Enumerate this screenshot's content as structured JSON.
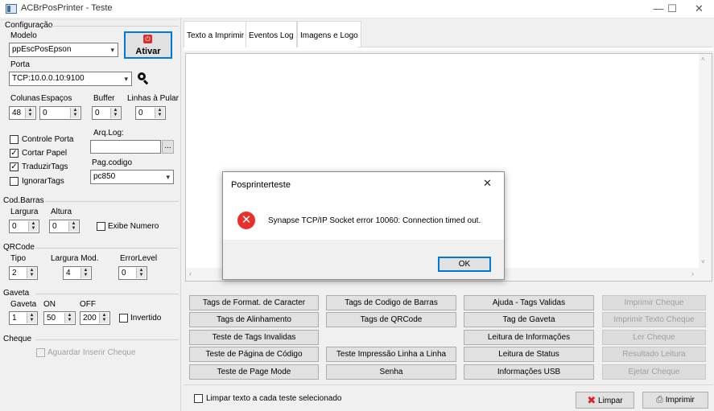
{
  "window": {
    "title": "ACBrPosPrinter - Teste",
    "minimize": "—",
    "maximize": "☐",
    "close": "✕"
  },
  "config": {
    "group_title": "Configuração",
    "modelo_label": "Modelo",
    "modelo_value": "ppEscPosEpson",
    "ativar_label": "Ativar",
    "porta_label": "Porta",
    "porta_value": "TCP:10.0.0.10:9100",
    "colunas_label": "Colunas",
    "colunas_value": "48",
    "espacos_label": "Espaços",
    "espacos_value": "0",
    "buffer_label": "Buffer",
    "buffer_value": "0",
    "linhas_label": "Linhas à Pular",
    "linhas_value": "0",
    "controle_porta": "Controle Porta",
    "cortar_papel": "Cortar Papel",
    "traduzir_tags": "TraduzirTags",
    "ignorar_tags": "IgnorarTags",
    "arqlog_label": "Arq.Log:",
    "arqlog_value": "",
    "browse": "...",
    "pagcodigo_label": "Pag.codigo",
    "pagcodigo_value": "pc850"
  },
  "codbarras": {
    "group_title": "Cod.Barras",
    "largura_label": "Largura",
    "largura_value": "0",
    "altura_label": "Altura",
    "altura_value": "0",
    "exibe_numero": "Exibe Numero"
  },
  "qrcode": {
    "group_title": "QRCode",
    "tipo_label": "Tipo",
    "tipo_value": "2",
    "largura_mod_label": "Largura Mod.",
    "largura_mod_value": "4",
    "error_level_label": "ErrorLevel",
    "error_level_value": "0"
  },
  "gaveta": {
    "group_title": "Gaveta",
    "gaveta_label": "Gaveta",
    "gaveta_value": "1",
    "on_label": "ON",
    "on_value": "50",
    "off_label": "OFF",
    "off_value": "200",
    "invertido": "Invertido"
  },
  "cheque": {
    "group_title": "Cheque",
    "aguardar": "Aguardar Inserir Cheque"
  },
  "tabs": [
    {
      "label": "Texto a Imprimir"
    },
    {
      "label": "Eventos Log"
    },
    {
      "label": "Imagens e Logo"
    }
  ],
  "buttons": {
    "col1": [
      "Tags de Format. de Caracter",
      "Tags de Alinhamento",
      "Teste de Tags Invalidas",
      "Teste de Página de Código",
      "Teste de Page Mode"
    ],
    "col2": [
      "Tags de Codigo de Barras",
      "Tags de QRCode",
      "Teste Impressão Linha a Linha",
      "Senha"
    ],
    "col3": [
      "Ajuda - Tags Validas",
      "Tag de Gaveta",
      "Leitura de Informações",
      "Leitura de Status",
      "Informações USB"
    ],
    "col4": [
      "Imprimir Cheque",
      "Imprimir Texto Cheque",
      "Ler Cheque",
      "Resultado Leitura",
      "Ejetar Cheque"
    ]
  },
  "bottom": {
    "limpar_check": "Limpar texto a cada teste selecionado",
    "limpar_btn": "Limpar",
    "imprimir_btn": "Imprimir"
  },
  "dialog": {
    "title": "Posprinterteste",
    "message": "Synapse TCP/IP Socket error 10060: Connection timed out.",
    "ok": "OK",
    "close": "✕"
  }
}
